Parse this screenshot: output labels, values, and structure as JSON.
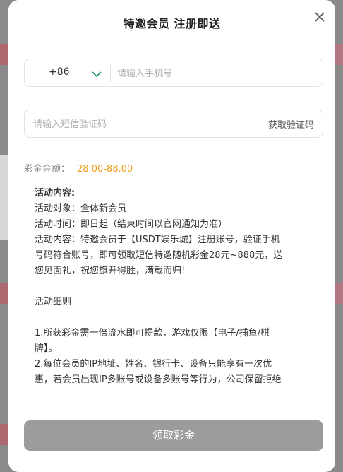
{
  "modal": {
    "title": "特邀会员 注册即送"
  },
  "phone": {
    "country_code": "+86",
    "placeholder": "请输入手机号",
    "value": ""
  },
  "sms": {
    "placeholder": "请输入短信验证码",
    "value": "",
    "get_code_label": "获取验证码"
  },
  "bonus": {
    "label": "彩金金额：",
    "value": "28.00-88.00",
    "color": "#f0a020"
  },
  "activity": {
    "heading": "活动内容:",
    "target": "活动对象：全体新会员",
    "time": "活动时间：即日起（结束时间以官网通知为准）",
    "desc_line1": "活动内容：特邀会员于【USDT娱乐城】注册账号，验证手机",
    "desc_line2": "号码符合账号，即可领取短信特邀随机彩金28元~888元，送",
    "desc_line3": "您见面礼，祝您旗开得胜，满载而归!",
    "rules_title": "活动细则",
    "rule1_line1": "1.所获彩金需一倍流水即可提款，游戏仅限【电子/捕鱼/棋",
    "rule1_line2": "牌】。",
    "rule2_line1": "2.每位会员的IP地址、姓名、银行卡、设备只能享有一次优",
    "rule2_line2": "惠，若会员出现IP多账号或设备多账号等行为，公司保留拒绝"
  },
  "actions": {
    "claim_label": "领取彩金"
  },
  "icons": {
    "close": "close-icon",
    "dropdown": "chevron-down-icon"
  },
  "colors": {
    "chevron": "#2a9d6f",
    "button_disabled": "#9c9c9c"
  }
}
